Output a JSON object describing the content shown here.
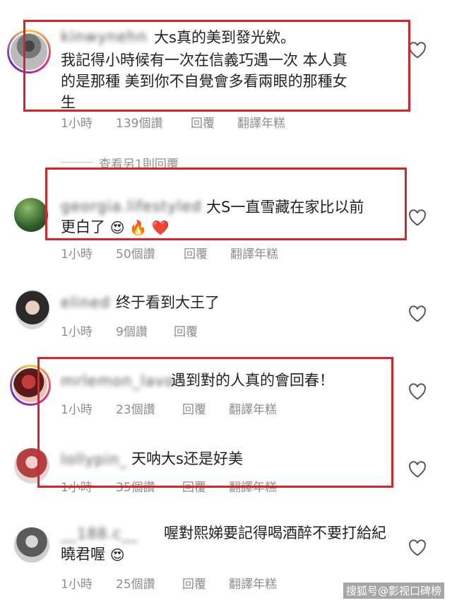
{
  "comments": [
    {
      "username": "kinwynehn",
      "text_lines": [
        "大s真的美到發光欸。",
        "我記得小時候有一次在信義巧遇一次 本人真",
        "的是那種 美到你不自覺會多看兩眼的那種女",
        "生"
      ],
      "time": "1小時",
      "likes": "139個讚",
      "reply": "回覆",
      "translate": "翻譯年糕"
    },
    {
      "username": "georgia.lifestyled",
      "text_lines": [
        "大S一直雪藏在家比以前",
        "更白了"
      ],
      "emojis": [
        "😍",
        "🔥",
        "❤️"
      ],
      "time": "1小時",
      "likes": "50個讚",
      "reply": "回覆",
      "translate": "翻譯年糕"
    },
    {
      "username": "elined",
      "text_lines": [
        "终于看到大王了"
      ],
      "time": "1小時",
      "likes": "9個讚",
      "reply": "回覆"
    },
    {
      "username": "mrlemon_lavo",
      "text_lines": [
        "遇到對的人真的會回春！"
      ],
      "time": "1小時",
      "likes": "23個讚",
      "reply": "回覆",
      "translate": "翻譯年糕"
    },
    {
      "username": "lollypin_",
      "text_lines": [
        "天呐大s还是好美"
      ],
      "time": "1小時",
      "likes": "35個讚",
      "reply": "回覆",
      "translate": "翻譯年糕"
    },
    {
      "username": "__188.c__",
      "text_lines": [
        "喔對熙娣要記得喝酒醉不要打給紀",
        "曉君喔"
      ],
      "emojis": [
        "😍"
      ],
      "time": "1小時",
      "likes": "25個讚",
      "reply": "回覆",
      "translate": "翻譯年糕"
    }
  ],
  "view_replies": "查看另1則回覆",
  "watermark": "搜狐号@影视口碑榜",
  "colors": {
    "highlight": "#d8232a",
    "meta": "#8e8e8e"
  }
}
